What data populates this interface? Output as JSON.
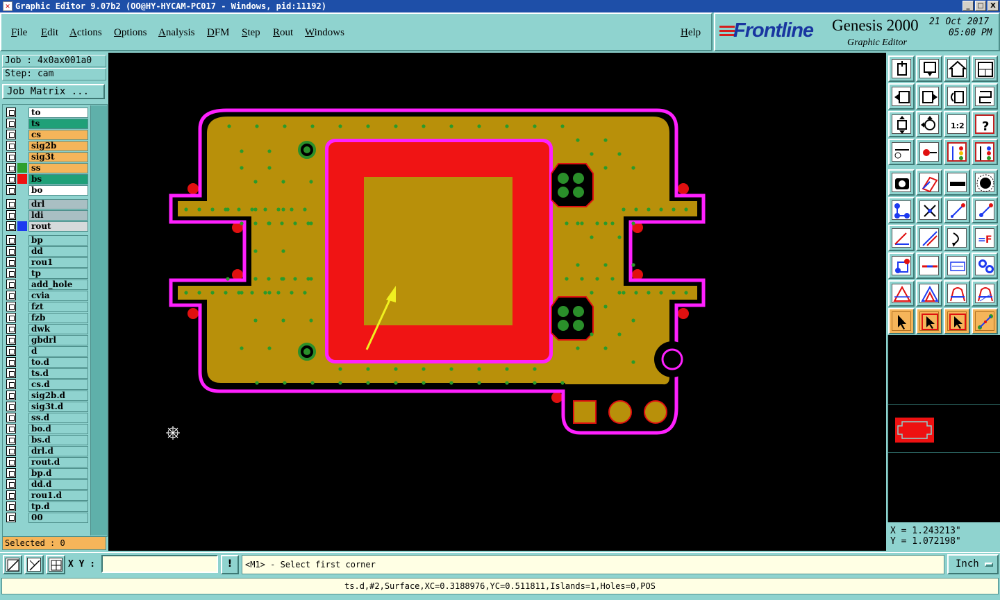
{
  "window": {
    "title": "Graphic Editor 9.07b2 (OO@HY-HYCAM-PC017 - Windows, pid:11192)"
  },
  "menu": [
    "File",
    "Edit",
    "Actions",
    "Options",
    "Analysis",
    "DFM",
    "Step",
    "Rout",
    "Windows"
  ],
  "help": "Help",
  "branding": {
    "brand": "Frontline",
    "product": "Genesis 2000",
    "subtitle": "Graphic Editor",
    "date": "21 Oct 2017",
    "time": "05:00 PM"
  },
  "job": {
    "job_label": "Job : 4x0ax001a0",
    "step_label": "Step: cam",
    "matrix_button": "Job Matrix ..."
  },
  "layers": [
    {
      "name": "to",
      "color": "#ffffff",
      "swatch": ""
    },
    {
      "name": "ts",
      "color": "#1fa078",
      "swatch": ""
    },
    {
      "name": "cs",
      "color": "#f5b55a",
      "swatch": ""
    },
    {
      "name": "sig2b",
      "color": "#f5b55a",
      "swatch": ""
    },
    {
      "name": "sig3t",
      "color": "#f5b55a",
      "swatch": ""
    },
    {
      "name": "ss",
      "color": "#f5b55a",
      "swatch": "#2ea02e"
    },
    {
      "name": "bs",
      "color": "#1fa078",
      "swatch": "#e11"
    },
    {
      "name": "bo",
      "color": "#ffffff",
      "swatch": ""
    },
    {
      "name": "drl",
      "color": "#a9bfc3",
      "swatch": ""
    },
    {
      "name": "ldi",
      "color": "#a9bfc3",
      "swatch": ""
    },
    {
      "name": "rout",
      "color": "#d5dadb",
      "swatch": "#1d3af0"
    },
    {
      "name": "bp",
      "color": "#8fd3cf",
      "swatch": ""
    },
    {
      "name": "dd",
      "color": "#8fd3cf",
      "swatch": ""
    },
    {
      "name": "rou1",
      "color": "#8fd3cf",
      "swatch": ""
    },
    {
      "name": "tp",
      "color": "#8fd3cf",
      "swatch": ""
    },
    {
      "name": "add_hole",
      "color": "#8fd3cf",
      "swatch": ""
    },
    {
      "name": "cvia",
      "color": "#8fd3cf",
      "swatch": ""
    },
    {
      "name": "fzt",
      "color": "#8fd3cf",
      "swatch": ""
    },
    {
      "name": "fzb",
      "color": "#8fd3cf",
      "swatch": ""
    },
    {
      "name": "dwk",
      "color": "#8fd3cf",
      "swatch": ""
    },
    {
      "name": "gbdrl",
      "color": "#8fd3cf",
      "swatch": ""
    },
    {
      "name": "d",
      "color": "#8fd3cf",
      "swatch": ""
    },
    {
      "name": "to.d",
      "color": "#8fd3cf",
      "swatch": ""
    },
    {
      "name": "ts.d",
      "color": "#8fd3cf",
      "swatch": ""
    },
    {
      "name": "cs.d",
      "color": "#8fd3cf",
      "swatch": ""
    },
    {
      "name": "sig2b.d",
      "color": "#8fd3cf",
      "swatch": ""
    },
    {
      "name": "sig3t.d",
      "color": "#8fd3cf",
      "swatch": ""
    },
    {
      "name": "ss.d",
      "color": "#8fd3cf",
      "swatch": ""
    },
    {
      "name": "bo.d",
      "color": "#8fd3cf",
      "swatch": ""
    },
    {
      "name": "bs.d",
      "color": "#8fd3cf",
      "swatch": ""
    },
    {
      "name": "drl.d",
      "color": "#8fd3cf",
      "swatch": ""
    },
    {
      "name": "rout.d",
      "color": "#8fd3cf",
      "swatch": ""
    },
    {
      "name": "bp.d",
      "color": "#8fd3cf",
      "swatch": ""
    },
    {
      "name": "dd.d",
      "color": "#8fd3cf",
      "swatch": ""
    },
    {
      "name": "rou1.d",
      "color": "#8fd3cf",
      "swatch": ""
    },
    {
      "name": "tp.d",
      "color": "#8fd3cf",
      "swatch": ""
    },
    {
      "name": "00",
      "color": "#8fd3cf",
      "swatch": ""
    }
  ],
  "selected": "Selected : 0",
  "coords": {
    "x": "X = 1.243213\"",
    "y": "Y = 1.072198\""
  },
  "tools": [
    "open-step-icon",
    "save-icon",
    "home-icon",
    "window-icon",
    "import-icon",
    "export-icon",
    "rotate-icon",
    "snap-icon",
    "zoom-fit-icon",
    "zoom-center-icon",
    "scale-1-2-icon",
    "help-icon",
    "measure-icon",
    "probe-icon",
    "layers-red-icon",
    "layers-blue-icon",
    "camera-icon",
    "pencil-shape-icon",
    "ruler-icon",
    "dot-icon",
    "connect-icon",
    "cross-icon",
    "line-add-icon",
    "line-del-icon",
    "angle-icon",
    "slash-icon",
    "arc-icon",
    "text-icon",
    "pad-icon",
    "bar-icon",
    "dim-icon",
    "pattern-icon",
    "triangle-red-icon",
    "triangle-blue-icon",
    "arch-icon",
    "arch-cross-icon",
    "pointer-icon",
    "pointer-box-icon",
    "pointer-select-icon",
    "route-icon"
  ],
  "bottom": {
    "xy_label": "X Y :",
    "xy_value": "",
    "warn": "!",
    "prompt": "<M1> - Select first corner",
    "units": "Inch"
  },
  "status": "ts.d,#2,Surface,XC=0.3188976,YC=0.511811,Islands=1,Holes=0,POS",
  "window_buttons": {
    "minimize": "_",
    "maximize": "□",
    "close": "X"
  }
}
